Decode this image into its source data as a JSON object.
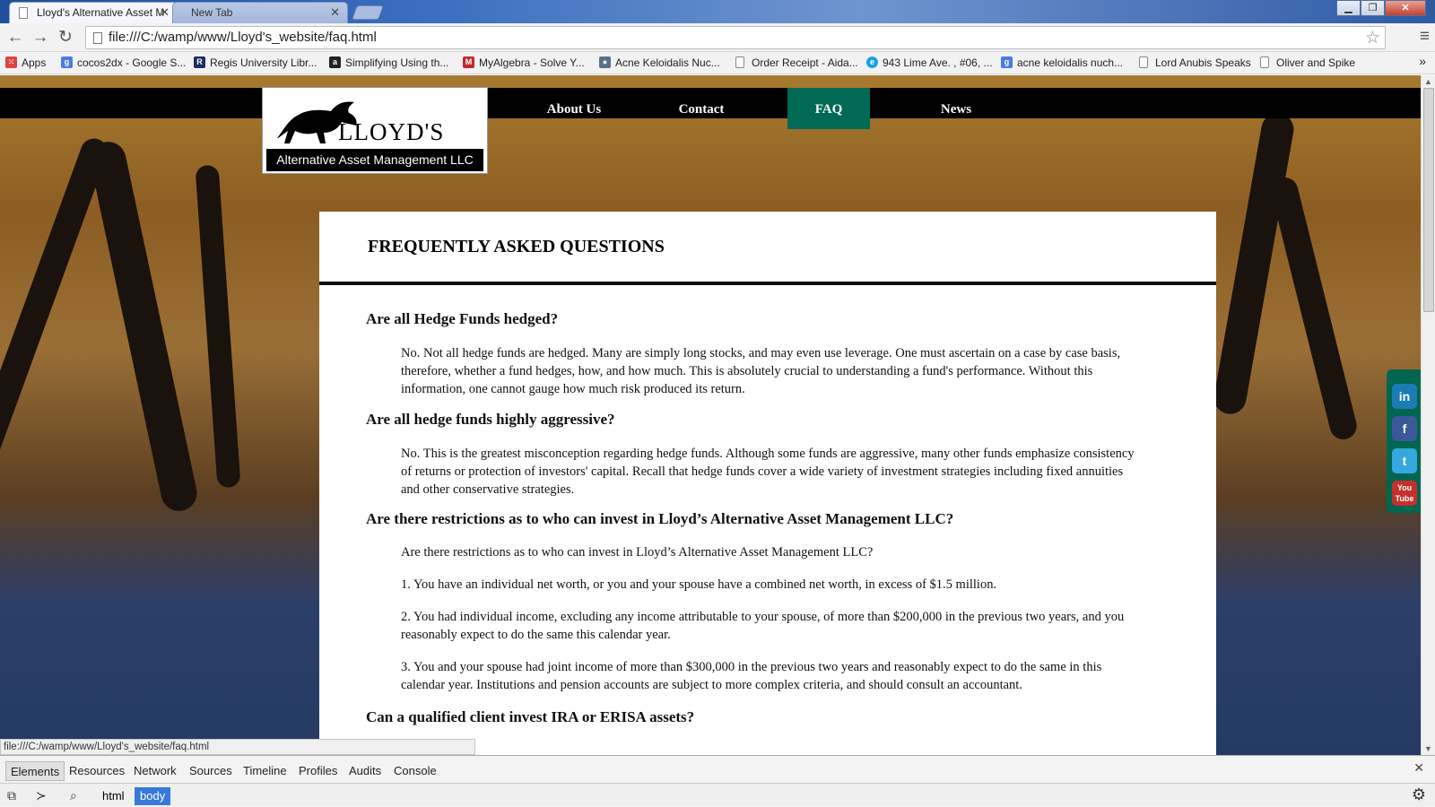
{
  "browser": {
    "tabs": [
      {
        "label": "Lloyd's Alternative Asset M"
      },
      {
        "label": "New Tab"
      }
    ],
    "url": "file:///C:/wamp/www/Lloyd's_website/faq.html",
    "status_url": "file:///C:/wamp/www/Lloyd's_website/faq.html",
    "bookmarks": [
      {
        "label": "Apps",
        "icon": "apps-grid-icon"
      },
      {
        "label": "cocos2dx - Google S...",
        "icon": "google-icon"
      },
      {
        "label": "Regis University Libr...",
        "icon": "regis-icon"
      },
      {
        "label": "Simplifying Using th...",
        "icon": "amazon-icon"
      },
      {
        "label": "MyAlgebra - Solve Y...",
        "icon": "myalgebra-icon"
      },
      {
        "label": "Acne Keloidalis Nuc...",
        "icon": "people-icon"
      },
      {
        "label": "Order Receipt - Aida...",
        "icon": "page-icon"
      },
      {
        "label": "943 Lime Ave. , #06, ...",
        "icon": "e-icon"
      },
      {
        "label": "acne keloidalis nuch...",
        "icon": "google-icon"
      },
      {
        "label": "Lord Anubis Speaks",
        "icon": "page-icon"
      },
      {
        "label": "Oliver and Spike",
        "icon": "page-icon"
      }
    ],
    "bookmarks_more": "»"
  },
  "site": {
    "logo": {
      "name": "LLOYD'S",
      "subtitle": "Alternative Asset Management LLC"
    },
    "nav": [
      {
        "label": "About Us"
      },
      {
        "label": "Contact"
      },
      {
        "label": "FAQ",
        "active": true
      },
      {
        "label": "News"
      }
    ],
    "accent_color": "#006a55",
    "page_title": "FREQUENTLY ASKED QUESTIONS",
    "faq": [
      {
        "question": "Are all Hedge Funds hedged?",
        "answer": "No. Not all hedge funds are hedged. Many are simply long stocks, and may even use leverage. One must ascertain on a case by case basis, therefore, whether a fund hedges, how, and how much. This is absolutely crucial to understanding a fund's performance. Without this information, one cannot gauge how much risk produced its return."
      },
      {
        "question": "Are all hedge funds highly aggressive?",
        "answer": "No. This is the greatest misconception regarding hedge funds. Although some funds are aggressive, many other funds emphasize consistency of returns or protection of investors' capital. Recall that hedge funds cover a wide variety of investment strategies including fixed annuities and other conservative strategies."
      },
      {
        "question": "Are there restrictions as to who can invest in Lloyd’s Alternative Asset Management LLC?",
        "answer_intro": "Are there restrictions as to who can invest in Lloyd’s Alternative Asset Management LLC?",
        "answer_items": [
          "1. You have an individual net worth, or you and your spouse have a combined net worth, in excess of $1.5 million.",
          "2. You had individual income, excluding any income attributable to your spouse, of more than $200,000 in the previous two years, and you reasonably expect to do the same this calendar year.",
          "3. You and your spouse had joint income of more than $300,000 in the previous two years and reasonably expect to do the same in this calendar year. Institutions and pension accounts are subject to more complex criteria, and should consult an accountant."
        ]
      },
      {
        "question": "Can a qualified client invest IRA or ERISA assets?"
      }
    ],
    "social": [
      {
        "label": "in",
        "icon": "linkedin-icon",
        "color": "#1b7bb5"
      },
      {
        "label": "f",
        "icon": "facebook-icon",
        "color": "#3b5998"
      },
      {
        "label": "t",
        "icon": "twitter-icon",
        "color": "#36a8e0"
      },
      {
        "label": "You Tube",
        "icon": "youtube-icon",
        "color": "#c4302b"
      }
    ]
  },
  "devtools": {
    "tabs": [
      "Elements",
      "Resources",
      "Network",
      "Sources",
      "Timeline",
      "Profiles",
      "Audits",
      "Console"
    ],
    "selected_tab": "Elements",
    "breadcrumbs": [
      "html",
      "body"
    ],
    "selected_crumb": "body"
  }
}
